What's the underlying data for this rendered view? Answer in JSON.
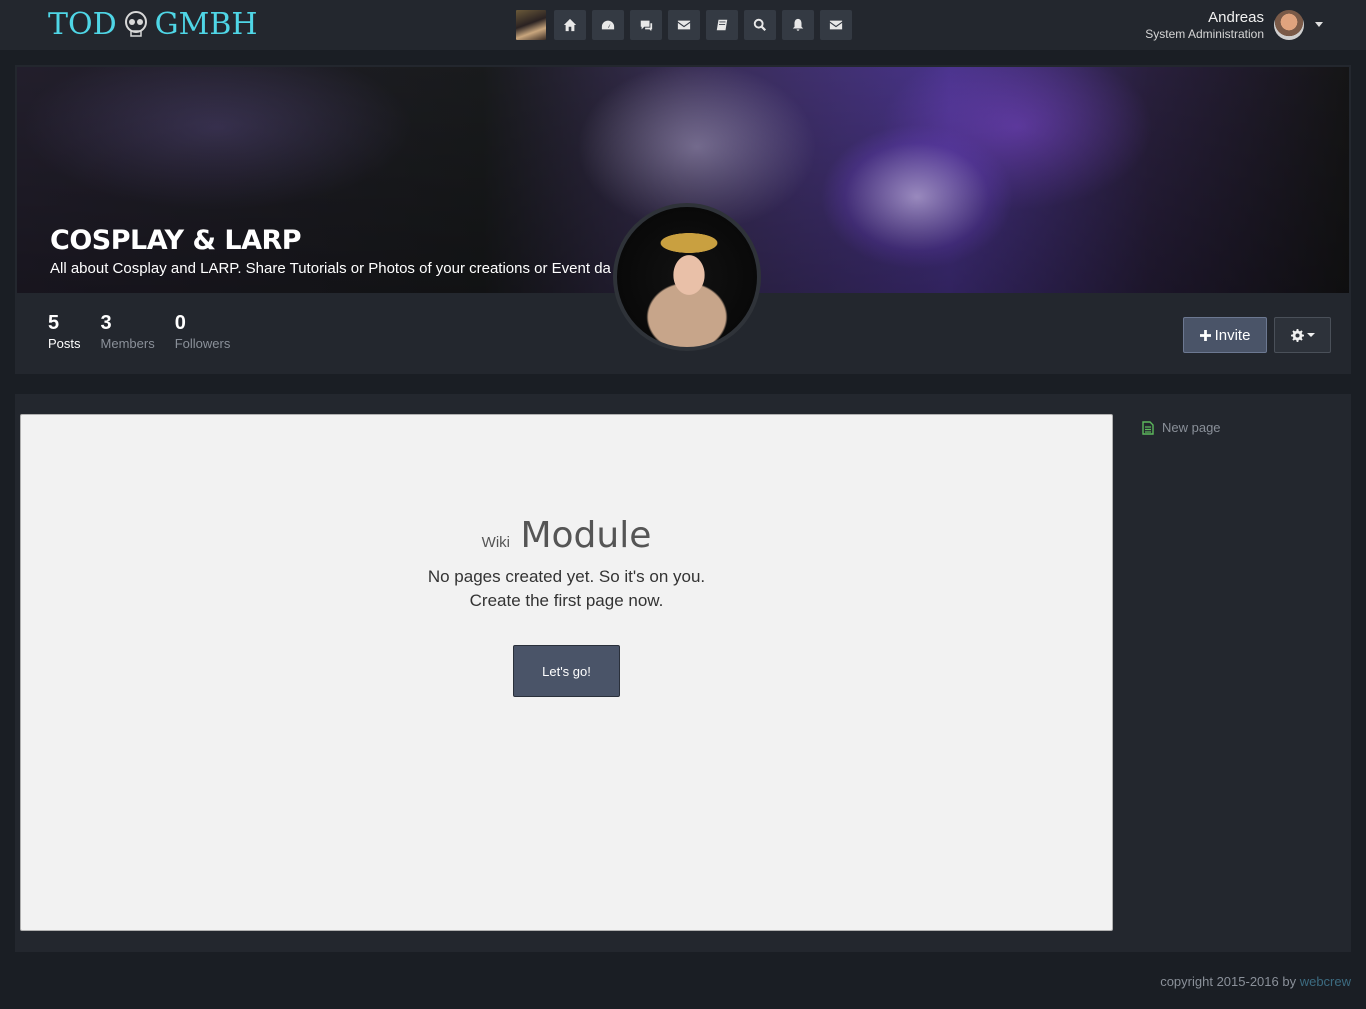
{
  "topbar": {
    "logo_text_left": "TOD",
    "logo_text_right": "GMBH",
    "nav_icons": [
      "space-thumbnail",
      "home-icon",
      "dashboard-icon",
      "comments-icon",
      "envelope-icon",
      "book-icon",
      "search-icon",
      "bell-icon",
      "envelope-icon"
    ],
    "user": {
      "name": "Andreas",
      "role": "System Administration"
    }
  },
  "space": {
    "title": "COSPLAY & LARP",
    "description": "All about Cosplay and LARP. Share Tutorials or Photos of your creations or Event da",
    "stats": [
      {
        "value": "5",
        "label": "Posts"
      },
      {
        "value": "3",
        "label": "Members"
      },
      {
        "value": "0",
        "label": "Followers"
      }
    ],
    "invite_label": "Invite",
    "settings_icon": "gear-icon"
  },
  "wiki": {
    "small_label": "Wiki",
    "big_label": "Module",
    "line1": "No pages created yet. So it's on you.",
    "line2": "Create the first page now.",
    "button_label": "Let's go!"
  },
  "sidebar": {
    "new_page_label": "New page"
  },
  "footer": {
    "copyright": "copyright 2015-2016 by",
    "link": "webcrew"
  },
  "colors": {
    "accent": "#4fd6e6",
    "button": "#4a5468",
    "background": "#1a1e24",
    "panel": "#23272e"
  }
}
